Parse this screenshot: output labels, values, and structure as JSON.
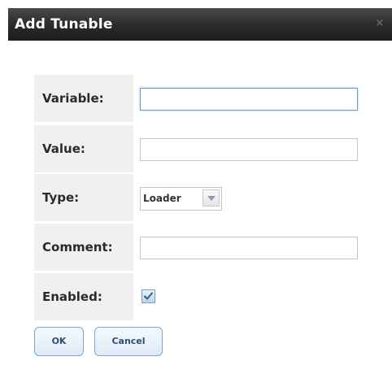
{
  "dialog": {
    "title": "Add Tunable",
    "close_glyph": "×"
  },
  "form": {
    "variable": {
      "label": "Variable:",
      "value": ""
    },
    "value": {
      "label": "Value:",
      "value": ""
    },
    "type": {
      "label": "Type:",
      "selected": "Loader"
    },
    "comment": {
      "label": "Comment:",
      "value": ""
    },
    "enabled": {
      "label": "Enabled:",
      "checked": true
    }
  },
  "buttons": {
    "ok_label": "OK",
    "cancel_label": "Cancel"
  },
  "colors": {
    "titlebar": "#1c1c1c",
    "label_background": "#f0f0f0",
    "button_border": "#7aa7d0"
  }
}
